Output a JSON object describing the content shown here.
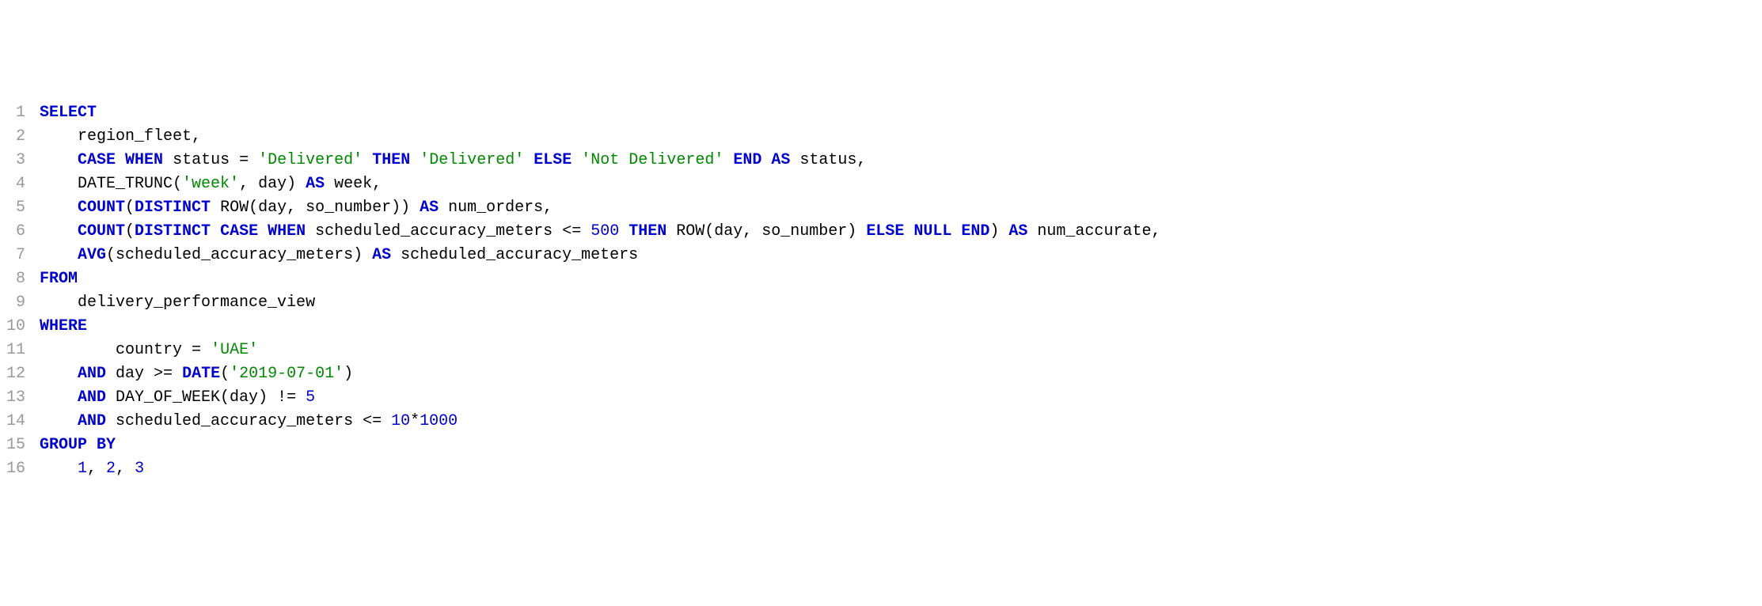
{
  "lines": [
    {
      "n": "1",
      "tokens": [
        {
          "t": "SELECT",
          "c": "kw"
        }
      ]
    },
    {
      "n": "2",
      "indent": "    ",
      "tokens": [
        {
          "t": "region_fleet,",
          "c": "id"
        }
      ]
    },
    {
      "n": "3",
      "indent": "    ",
      "tokens": [
        {
          "t": "CASE",
          "c": "kw"
        },
        {
          "t": " "
        },
        {
          "t": "WHEN",
          "c": "kw"
        },
        {
          "t": " "
        },
        {
          "t": "status",
          "c": "id"
        },
        {
          "t": " "
        },
        {
          "t": "=",
          "c": "op"
        },
        {
          "t": " "
        },
        {
          "t": "'Delivered'",
          "c": "str"
        },
        {
          "t": " "
        },
        {
          "t": "THEN",
          "c": "kw"
        },
        {
          "t": " "
        },
        {
          "t": "'Delivered'",
          "c": "str"
        },
        {
          "t": " "
        },
        {
          "t": "ELSE",
          "c": "kw"
        },
        {
          "t": " "
        },
        {
          "t": "'Not Delivered'",
          "c": "str"
        },
        {
          "t": " "
        },
        {
          "t": "END",
          "c": "kw"
        },
        {
          "t": " "
        },
        {
          "t": "AS",
          "c": "kw"
        },
        {
          "t": " "
        },
        {
          "t": "status,",
          "c": "id"
        }
      ]
    },
    {
      "n": "4",
      "indent": "    ",
      "tokens": [
        {
          "t": "DATE_TRUNC(",
          "c": "id"
        },
        {
          "t": "'week'",
          "c": "str"
        },
        {
          "t": ", day) ",
          "c": "id"
        },
        {
          "t": "AS",
          "c": "kw"
        },
        {
          "t": " week,",
          "c": "id"
        }
      ]
    },
    {
      "n": "5",
      "indent": "    ",
      "tokens": [
        {
          "t": "COUNT",
          "c": "fn"
        },
        {
          "t": "(",
          "c": "punc"
        },
        {
          "t": "DISTINCT",
          "c": "kw"
        },
        {
          "t": " ROW(day, so_number)) ",
          "c": "id"
        },
        {
          "t": "AS",
          "c": "kw"
        },
        {
          "t": " num_orders,",
          "c": "id"
        }
      ]
    },
    {
      "n": "6",
      "indent": "    ",
      "tokens": [
        {
          "t": "COUNT",
          "c": "fn"
        },
        {
          "t": "(",
          "c": "punc"
        },
        {
          "t": "DISTINCT",
          "c": "kw"
        },
        {
          "t": " "
        },
        {
          "t": "CASE",
          "c": "kw"
        },
        {
          "t": " "
        },
        {
          "t": "WHEN",
          "c": "kw"
        },
        {
          "t": " scheduled_accuracy_meters ",
          "c": "id"
        },
        {
          "t": "<=",
          "c": "op"
        },
        {
          "t": " "
        },
        {
          "t": "500",
          "c": "num"
        },
        {
          "t": " "
        },
        {
          "t": "THEN",
          "c": "kw"
        },
        {
          "t": " ROW(day, so_number) ",
          "c": "id"
        },
        {
          "t": "ELSE",
          "c": "kw"
        },
        {
          "t": " "
        },
        {
          "t": "NULL",
          "c": "kw"
        },
        {
          "t": " "
        },
        {
          "t": "END",
          "c": "kw"
        },
        {
          "t": ") ",
          "c": "punc"
        },
        {
          "t": "AS",
          "c": "kw"
        },
        {
          "t": " num_accurate,",
          "c": "id"
        }
      ]
    },
    {
      "n": "7",
      "indent": "    ",
      "tokens": [
        {
          "t": "AVG",
          "c": "fn"
        },
        {
          "t": "(scheduled_accuracy_meters) ",
          "c": "id"
        },
        {
          "t": "AS",
          "c": "kw"
        },
        {
          "t": " scheduled_accuracy_meters",
          "c": "id"
        }
      ]
    },
    {
      "n": "8",
      "tokens": [
        {
          "t": "FROM",
          "c": "kw"
        }
      ]
    },
    {
      "n": "9",
      "indent": "    ",
      "tokens": [
        {
          "t": "delivery_performance_view",
          "c": "id"
        }
      ]
    },
    {
      "n": "10",
      "tokens": [
        {
          "t": "WHERE",
          "c": "kw"
        }
      ]
    },
    {
      "n": "11",
      "indent": "        ",
      "tokens": [
        {
          "t": "country ",
          "c": "id"
        },
        {
          "t": "=",
          "c": "op"
        },
        {
          "t": " "
        },
        {
          "t": "'UAE'",
          "c": "str"
        }
      ]
    },
    {
      "n": "12",
      "indent": "    ",
      "tokens": [
        {
          "t": "AND",
          "c": "kw"
        },
        {
          "t": " day ",
          "c": "id"
        },
        {
          "t": ">=",
          "c": "op"
        },
        {
          "t": " "
        },
        {
          "t": "DATE",
          "c": "fn"
        },
        {
          "t": "(",
          "c": "punc"
        },
        {
          "t": "'2019-07-01'",
          "c": "str"
        },
        {
          "t": ")",
          "c": "punc"
        }
      ]
    },
    {
      "n": "13",
      "indent": "    ",
      "tokens": [
        {
          "t": "AND",
          "c": "kw"
        },
        {
          "t": " DAY_OF_WEEK(day) ",
          "c": "id"
        },
        {
          "t": "!=",
          "c": "op"
        },
        {
          "t": " "
        },
        {
          "t": "5",
          "c": "num"
        }
      ]
    },
    {
      "n": "14",
      "indent": "    ",
      "tokens": [
        {
          "t": "AND",
          "c": "kw"
        },
        {
          "t": " scheduled_accuracy_meters ",
          "c": "id"
        },
        {
          "t": "<=",
          "c": "op"
        },
        {
          "t": " "
        },
        {
          "t": "10",
          "c": "num"
        },
        {
          "t": "*",
          "c": "op"
        },
        {
          "t": "1000",
          "c": "num"
        }
      ]
    },
    {
      "n": "15",
      "tokens": [
        {
          "t": "GROUP",
          "c": "kw"
        },
        {
          "t": " "
        },
        {
          "t": "BY",
          "c": "kw"
        }
      ]
    },
    {
      "n": "16",
      "indent": "    ",
      "tokens": [
        {
          "t": "1",
          "c": "num"
        },
        {
          "t": ", ",
          "c": "punc"
        },
        {
          "t": "2",
          "c": "num"
        },
        {
          "t": ", ",
          "c": "punc"
        },
        {
          "t": "3",
          "c": "num"
        }
      ]
    }
  ]
}
